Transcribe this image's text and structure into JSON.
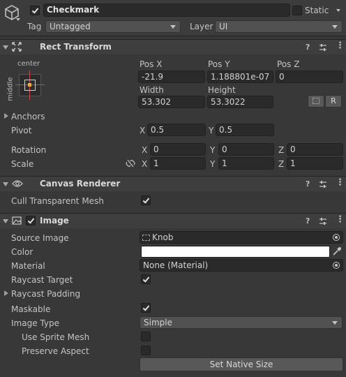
{
  "header": {
    "name_value": "Checkmark",
    "static_label": "Static",
    "tag_label": "Tag",
    "tag_value": "Untagged",
    "layer_label": "Layer",
    "layer_value": "UI",
    "active_checked": true,
    "static_checked": false
  },
  "rect_transform": {
    "title": "Rect Transform",
    "anchor_preset_h": "center",
    "anchor_preset_v": "middle",
    "pos_x_label": "Pos X",
    "pos_y_label": "Pos Y",
    "pos_z_label": "Pos Z",
    "pos_x": "-21.9",
    "pos_y": "1.188801e-07",
    "pos_z": "0",
    "width_label": "Width",
    "height_label": "Height",
    "width": "53.302",
    "height": "53.3022",
    "raw_edit_label": "R",
    "anchors_label": "Anchors",
    "pivot_label": "Pivot",
    "pivot_x": "0.5",
    "pivot_y": "0.5",
    "rotation_label": "Rotation",
    "rotation_x": "0",
    "rotation_y": "0",
    "rotation_z": "0",
    "scale_label": "Scale",
    "scale_x": "1",
    "scale_y": "1",
    "scale_z": "1",
    "axis_x": "X",
    "axis_y": "Y",
    "axis_z": "Z"
  },
  "canvas_renderer": {
    "title": "Canvas Renderer",
    "cull_label": "Cull Transparent Mesh",
    "cull_checked": true
  },
  "image": {
    "title": "Image",
    "enabled": true,
    "source_image_label": "Source Image",
    "source_image_value": "Knob",
    "color_label": "Color",
    "color_value": "#ffffff",
    "material_label": "Material",
    "material_value": "None (Material)",
    "raycast_target_label": "Raycast Target",
    "raycast_target_checked": true,
    "raycast_padding_label": "Raycast Padding",
    "maskable_label": "Maskable",
    "maskable_checked": true,
    "image_type_label": "Image Type",
    "image_type_value": "Simple",
    "use_sprite_mesh_label": "Use Sprite Mesh",
    "use_sprite_mesh_checked": false,
    "preserve_aspect_label": "Preserve Aspect",
    "preserve_aspect_checked": false,
    "set_native_size_label": "Set Native Size"
  },
  "icons": {
    "gameobject": "cube-icon",
    "rect_transform": "rect-transform-icon",
    "canvas_renderer": "eye-icon",
    "image": "image-icon",
    "help": "help-icon",
    "presets": "sliders-icon",
    "menu": "kebab-menu-icon",
    "constrain": "link-broken-icon",
    "blueprint": "blueprint-icon",
    "picker": "object-picker-icon",
    "eyedropper": "eyedropper-icon"
  }
}
